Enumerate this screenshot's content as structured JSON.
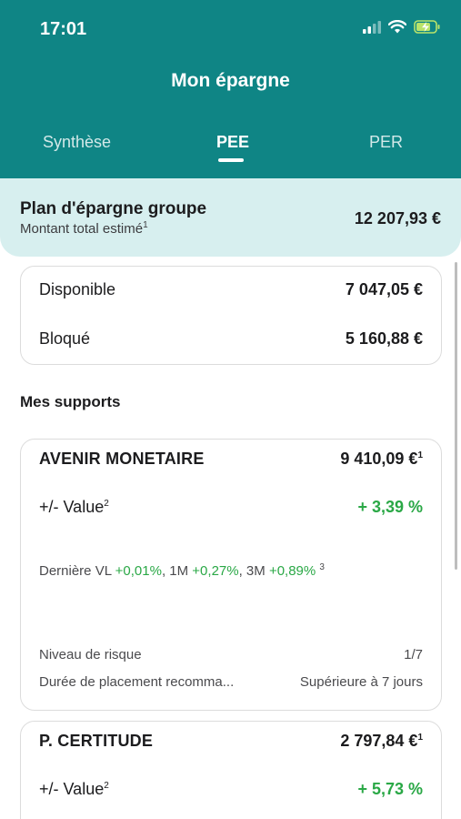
{
  "status_bar": {
    "time": "17:01"
  },
  "header": {
    "title": "Mon épargne"
  },
  "tabs": [
    {
      "label": "Synthèse",
      "active": false
    },
    {
      "label": "PEE",
      "active": true
    },
    {
      "label": "PER",
      "active": false
    }
  ],
  "summary": {
    "title": "Plan d'épargne groupe",
    "subtitle": "Montant total estimé",
    "subtitle_note": "1",
    "amount": "12 207,93 €"
  },
  "availability": {
    "available_label": "Disponible",
    "available_value": "7 047,05 €",
    "blocked_label": "Bloqué",
    "blocked_value": "5 160,88 €"
  },
  "supports": {
    "section_title": "Mes supports",
    "items": [
      {
        "name": "AVENIR MONETAIRE",
        "amount": "9 410,09 €",
        "amount_note": "1",
        "plus_label": "+/- Value",
        "plus_note": "2",
        "plus_value": "+ 3,39 %",
        "vl_prefix": "Dernière VL ",
        "vl_day": "+0,01%",
        "vl_1m_label": ", 1M ",
        "vl_1m": "+0,27%",
        "vl_3m_label": ", 3M ",
        "vl_3m": "+0,89%",
        "vl_note": "3",
        "risk_label": "Niveau de risque",
        "risk_value": "1/7",
        "duration_label": "Durée de placement recomma...",
        "duration_value": "Supérieure à 7 jours"
      },
      {
        "name": "P. CERTITUDE",
        "amount": "2 797,84 €",
        "amount_note": "1",
        "plus_label": "+/- Value",
        "plus_note": "2",
        "plus_value": "+ 5,73 %"
      }
    ]
  },
  "colors": {
    "header_bg": "#0f8585",
    "summary_bg": "#d7efef",
    "positive": "#2aa846"
  },
  "icons": [
    "cellular-signal-icon",
    "wifi-icon",
    "battery-charging-icon"
  ]
}
